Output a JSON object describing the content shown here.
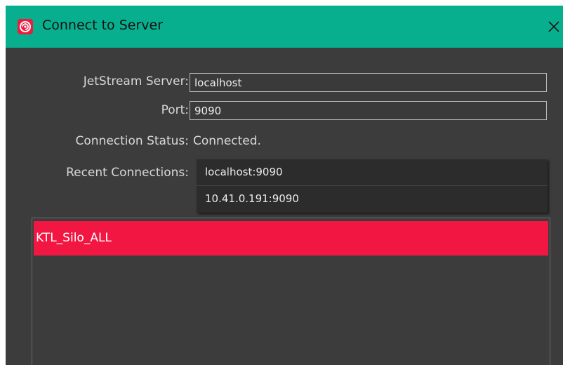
{
  "window": {
    "title": "Connect to Server",
    "icon": "app-logo-icon",
    "close_icon": "close-icon",
    "titlebar_color": "#07af8f"
  },
  "form": {
    "server_label": "JetStream Server:",
    "server_value": "localhost",
    "port_label": "Port:",
    "port_value": "9090",
    "status_label": "Connection Status:",
    "status_value": "Connected.",
    "recent_label": "Recent Connections:"
  },
  "recent_connections": [
    {
      "label": "localhost:9090"
    },
    {
      "label": "10.41.0.191:9090"
    }
  ],
  "streams": {
    "items": [
      {
        "label": "KTL_Silo_ALL",
        "selected": true
      }
    ],
    "selected_color": "#f21643"
  }
}
